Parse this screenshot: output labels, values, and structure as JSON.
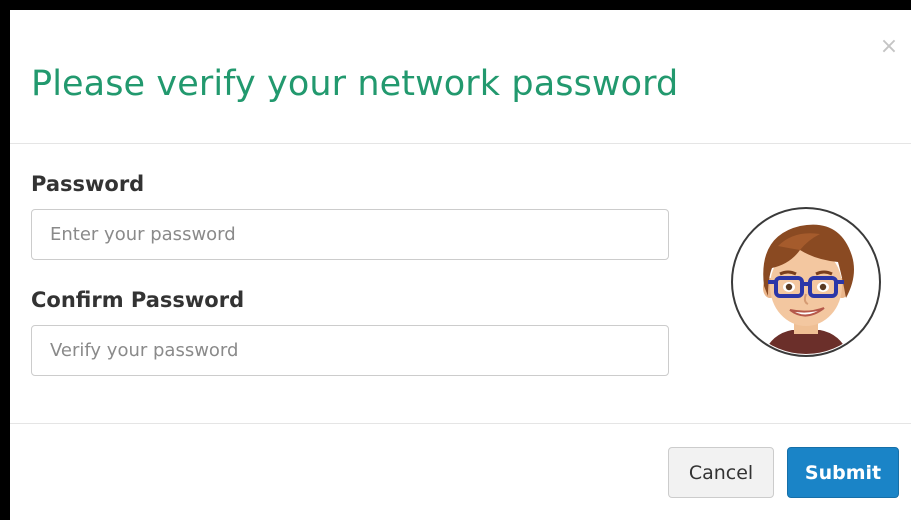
{
  "modal": {
    "close_glyph": "×",
    "title": "Please verify your network password",
    "accent_color": "#22996e"
  },
  "form": {
    "password_label": "Password",
    "password_placeholder": "Enter your password",
    "password_value": "",
    "confirm_label": "Confirm Password",
    "confirm_placeholder": "Verify your password",
    "confirm_value": ""
  },
  "avatar": {
    "icon": "cartoon-person-with-glasses"
  },
  "footer": {
    "cancel_label": "Cancel",
    "submit_label": "Submit",
    "submit_color": "#1a84c7"
  }
}
